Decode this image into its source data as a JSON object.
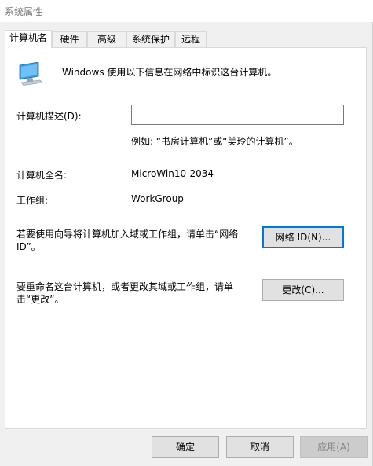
{
  "window": {
    "title": "系统属性"
  },
  "tabs": [
    {
      "label": "计算机名"
    },
    {
      "label": "硬件"
    },
    {
      "label": "高级"
    },
    {
      "label": "系统保护"
    },
    {
      "label": "远程"
    }
  ],
  "panel": {
    "intro_text": "Windows 使用以下信息在网络中标识这台计算机。",
    "description_label": "计算机描述(D):",
    "description_value": "",
    "description_example": "例如: “书房计算机”或“美玲的计算机”。",
    "full_name_label": "计算机全名:",
    "full_name_value": "MicroWin10-2034",
    "workgroup_label": "工作组:",
    "workgroup_value": "WorkGroup",
    "network_id_text": "若要使用向导将计算机加入域或工作组，请单击“网络 ID”。",
    "network_id_button": "网络 ID(N)...",
    "change_text": "要重命名这台计算机，或者更改其域或工作组，请单击“更改”。",
    "change_button": "更改(C)..."
  },
  "footer": {
    "ok_button": "确定",
    "cancel_button": "取消",
    "apply_button": "应用(A)"
  },
  "icons": {
    "computer": "computer-monitor-icon"
  },
  "colors": {
    "focus": "#0078d7",
    "panel": "#ffffff",
    "window": "#f0f0f0"
  }
}
